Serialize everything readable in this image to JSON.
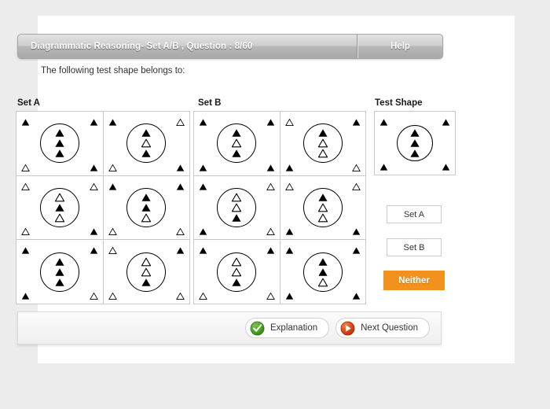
{
  "header": {
    "title": "Diagrammatic Reasoning- Set A/B , Question : 8/60",
    "help_label": "Help"
  },
  "prompt": "The following test shape belongs to:",
  "labels": {
    "set_a": "Set A",
    "set_b": "Set B",
    "test_shape": "Test Shape"
  },
  "answers": {
    "set_a": "Set A",
    "set_b": "Set B",
    "neither": "Neither"
  },
  "footer": {
    "explanation": "Explanation",
    "next_question": "Next Question",
    "explanation_icon": "check-circle-icon",
    "next_icon": "play-circle-icon"
  },
  "colors": {
    "page_background": "#ececec",
    "card_background": "#ffffff",
    "titlebar_gradient_top": "#e2e2e2",
    "titlebar_gradient_bottom": "#a9a9a9",
    "neither_button": "#f2921d",
    "grid_border": "#c9c9c9",
    "shape_stroke": "#000000",
    "explanation_icon_color": "#3f9421",
    "next_icon_color": "#d8411e"
  },
  "shapes": {
    "set_a": [
      {
        "corners": {
          "tl": "filled",
          "tr": "filled",
          "bl": "hollow",
          "br": "filled"
        },
        "inner": [
          "filled",
          "filled",
          "filled"
        ]
      },
      {
        "corners": {
          "tl": "filled",
          "tr": "hollow",
          "bl": "hollow",
          "br": "filled"
        },
        "inner": [
          "filled",
          "hollow",
          "filled"
        ]
      },
      {
        "corners": {
          "tl": "hollow",
          "tr": "hollow",
          "bl": "hollow",
          "br": "filled"
        },
        "inner": [
          "hollow",
          "filled",
          "hollow"
        ]
      },
      {
        "corners": {
          "tl": "filled",
          "tr": "filled",
          "bl": "hollow",
          "br": "hollow"
        },
        "inner": [
          "filled",
          "filled",
          "hollow"
        ]
      },
      {
        "corners": {
          "tl": "filled",
          "tr": "filled",
          "bl": "filled",
          "br": "hollow"
        },
        "inner": [
          "filled",
          "filled",
          "filled"
        ]
      },
      {
        "corners": {
          "tl": "hollow",
          "tr": "filled",
          "bl": "hollow",
          "br": "hollow"
        },
        "inner": [
          "hollow",
          "hollow",
          "filled"
        ]
      }
    ],
    "set_b": [
      {
        "corners": {
          "tl": "filled",
          "tr": "filled",
          "bl": "filled",
          "br": "filled"
        },
        "inner": [
          "filled",
          "hollow",
          "filled"
        ]
      },
      {
        "corners": {
          "tl": "hollow",
          "tr": "filled",
          "bl": "filled",
          "br": "hollow"
        },
        "inner": [
          "filled",
          "hollow",
          "hollow"
        ]
      },
      {
        "corners": {
          "tl": "filled",
          "tr": "hollow",
          "bl": "filled",
          "br": "hollow"
        },
        "inner": [
          "hollow",
          "hollow",
          "filled"
        ]
      },
      {
        "corners": {
          "tl": "hollow",
          "tr": "hollow",
          "bl": "filled",
          "br": "filled"
        },
        "inner": [
          "filled",
          "hollow",
          "hollow"
        ]
      },
      {
        "corners": {
          "tl": "filled",
          "tr": "filled",
          "bl": "hollow",
          "br": "hollow"
        },
        "inner": [
          "hollow",
          "hollow",
          "filled"
        ]
      },
      {
        "corners": {
          "tl": "filled",
          "tr": "filled",
          "bl": "filled",
          "br": "filled"
        },
        "inner": [
          "filled",
          "filled",
          "hollow"
        ]
      }
    ],
    "test": {
      "corners": {
        "tl": "filled",
        "tr": "filled",
        "bl": "filled",
        "br": "filled"
      },
      "inner": [
        "filled",
        "filled",
        "filled"
      ]
    }
  }
}
